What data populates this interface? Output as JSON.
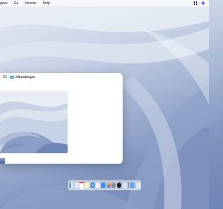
{
  "menubar": {
    "items": [
      "gave",
      "Ga",
      "Venster",
      "Help"
    ],
    "right_icons": [
      "control-center-icon",
      "siri-icon"
    ]
  },
  "window": {
    "title": "Afbeeldingen",
    "title_icon": "folder-icon"
  },
  "dock": {
    "apps": [
      "finder-icon",
      "launchpad-icon",
      "calendar-icon",
      "notes-icon",
      "safari-icon",
      "textedit-icon",
      "mail-icon",
      "photos-icon",
      "settings-icon",
      "github-icon",
      "preview-icon"
    ],
    "right_items": [
      "downloads-folder-icon",
      "trash-icon"
    ]
  },
  "colors": {
    "wallpaper_top": "#e7ecf4",
    "wallpaper_bottom": "#6e84b3",
    "folder_blue": "#4a9bea"
  }
}
